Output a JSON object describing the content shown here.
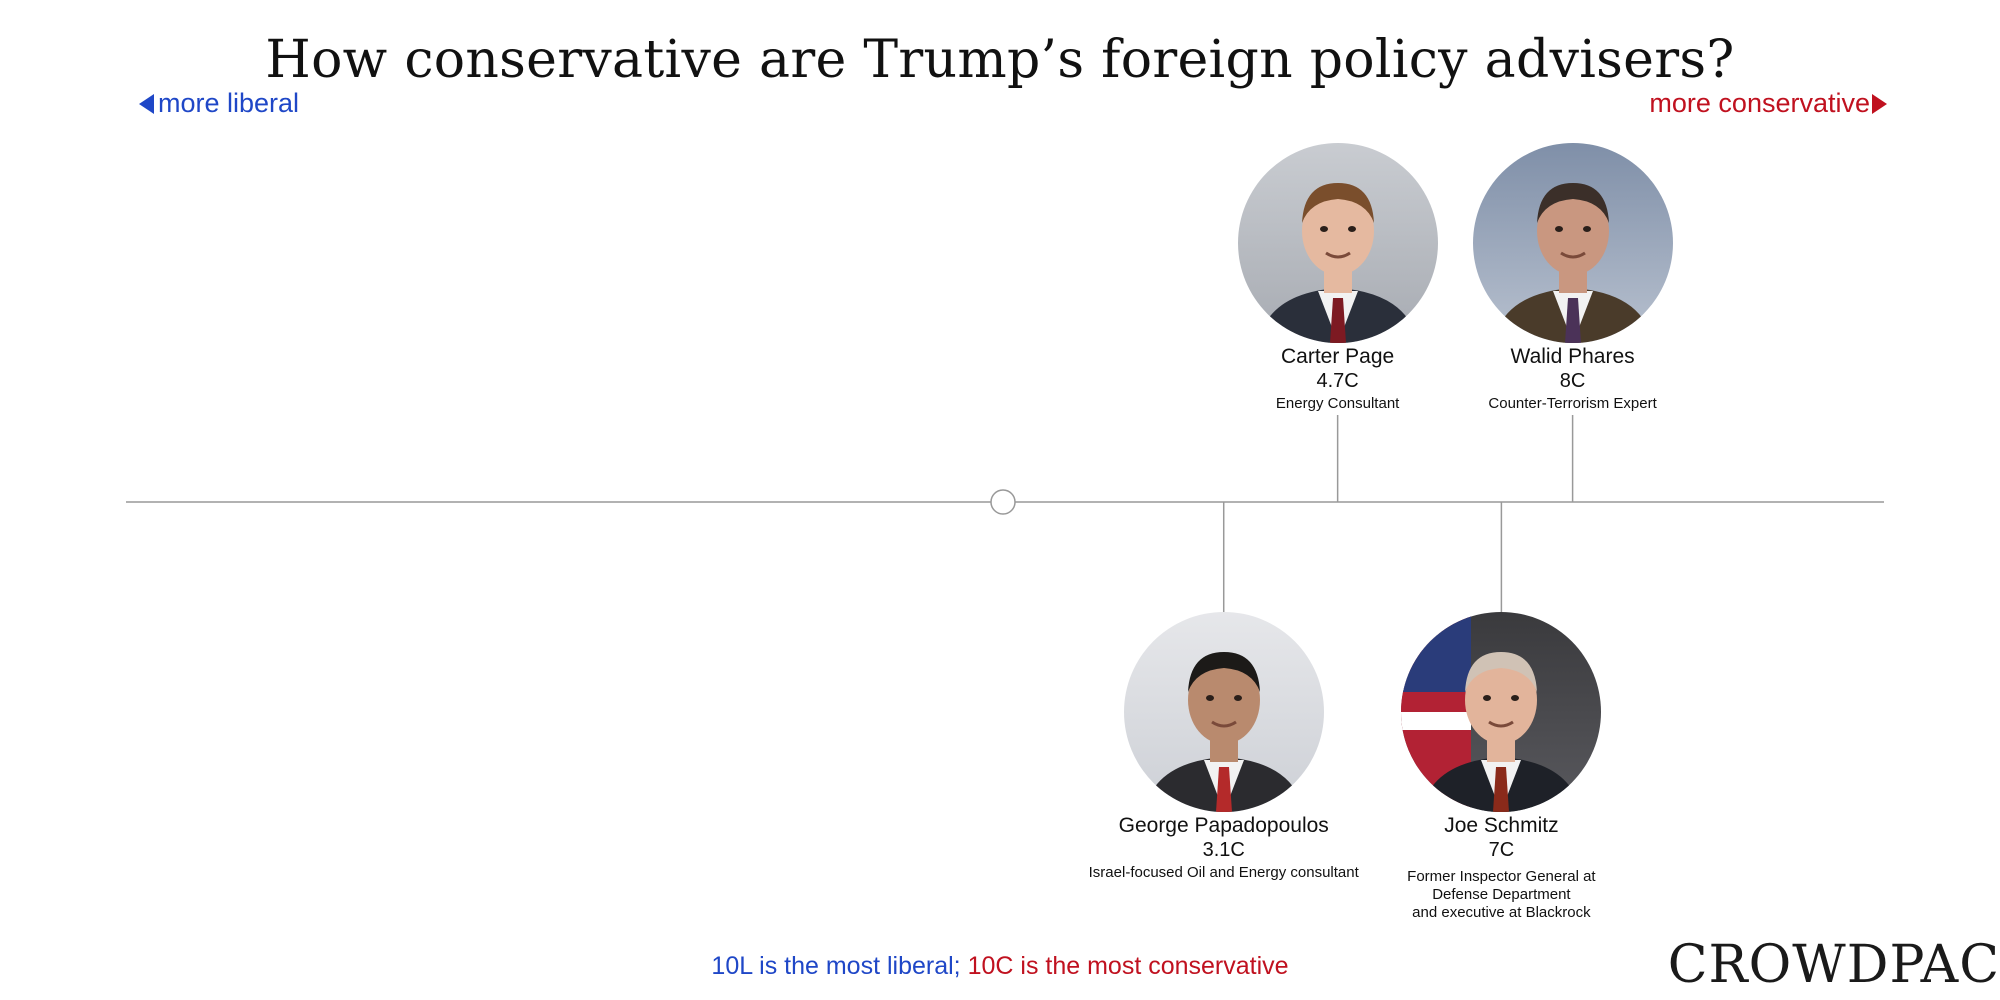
{
  "title": "How conservative are Trump’s foreign policy advisers?",
  "axis": {
    "left_label": "more liberal",
    "right_label": "more conservative",
    "left_color": "#1f47c7",
    "right_color": "#c0111f"
  },
  "chart_data": {
    "type": "scatter",
    "title": "How conservative are Trump’s foreign policy advisers?",
    "xlim": [
      -10,
      10
    ],
    "scale_note_liberal": "10L is the most liberal",
    "scale_note_separator": ";",
    "scale_note_conservative": "10C is the most conservative",
    "points": [
      {
        "name": "Carter Page",
        "score": 4.7,
        "score_label": "4.7C",
        "role": "Energy Consultant",
        "side": "above"
      },
      {
        "name": "Walid Phares",
        "score": 8.0,
        "score_label": "8C",
        "role": "Counter-Terrorism Expert",
        "side": "above"
      },
      {
        "name": "George Papadopoulos",
        "score": 3.1,
        "score_label": "3.1C",
        "role": "Israel-focused Oil and Energy consultant",
        "side": "below"
      },
      {
        "name": "Joe Schmitz",
        "score": 7.0,
        "score_label": "7C",
        "role": "Former Inspector General at\nDefense Department\nand executive at Blackrock",
        "side": "below"
      }
    ]
  },
  "logo": "CROWDPAC"
}
